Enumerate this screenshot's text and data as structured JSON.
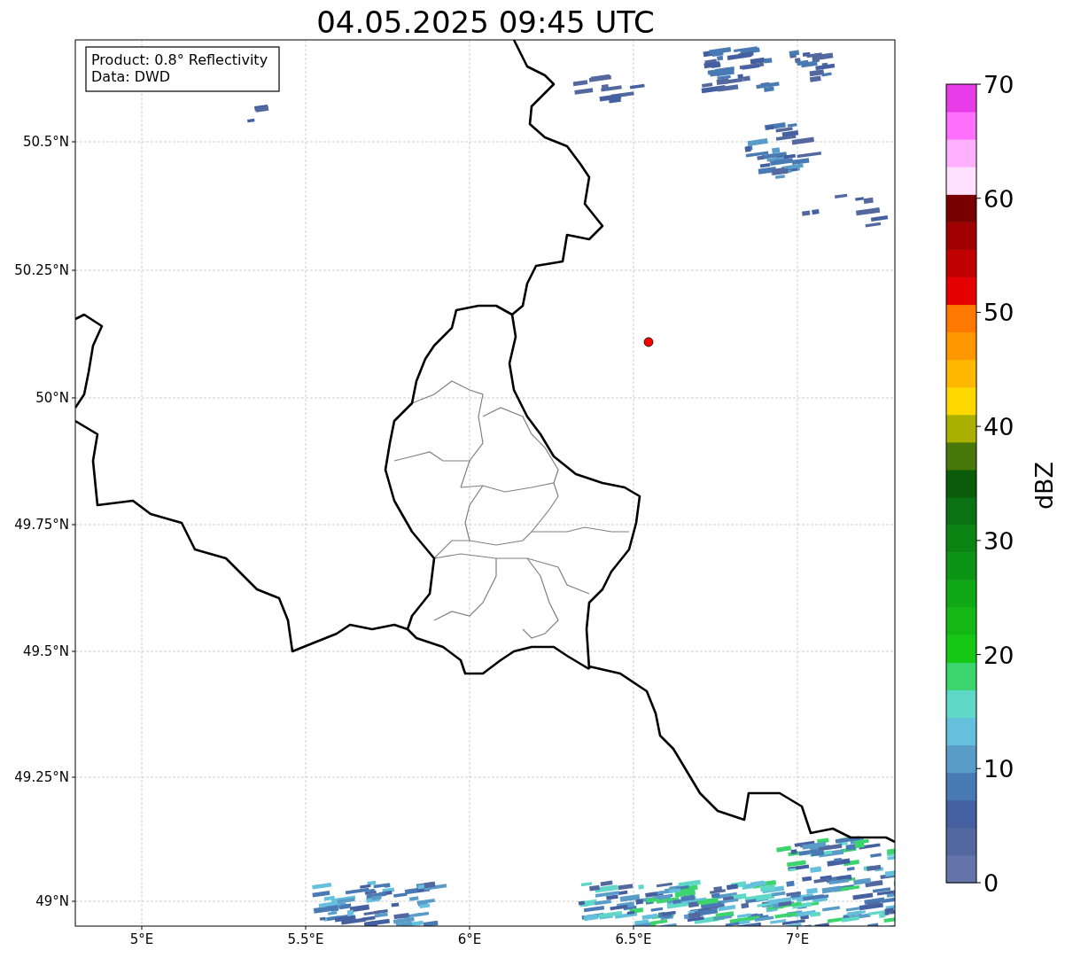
{
  "title": "04.05.2025 09:45 UTC",
  "info_box": [
    "Product: 0.8° Reflectivity",
    "Data: DWD"
  ],
  "map": {
    "xticks": [
      "5°E",
      "5.5°E",
      "6°E",
      "6.5°E",
      "7°E"
    ],
    "yticks": [
      "50.5°N",
      "50.25°N",
      "50°N",
      "49.75°N",
      "49.5°N",
      "49.25°N",
      "49°N"
    ]
  },
  "colorbar": {
    "label": "dBZ",
    "ticks": [
      "70",
      "60",
      "50",
      "40",
      "30",
      "20",
      "10",
      "0"
    ]
  }
}
